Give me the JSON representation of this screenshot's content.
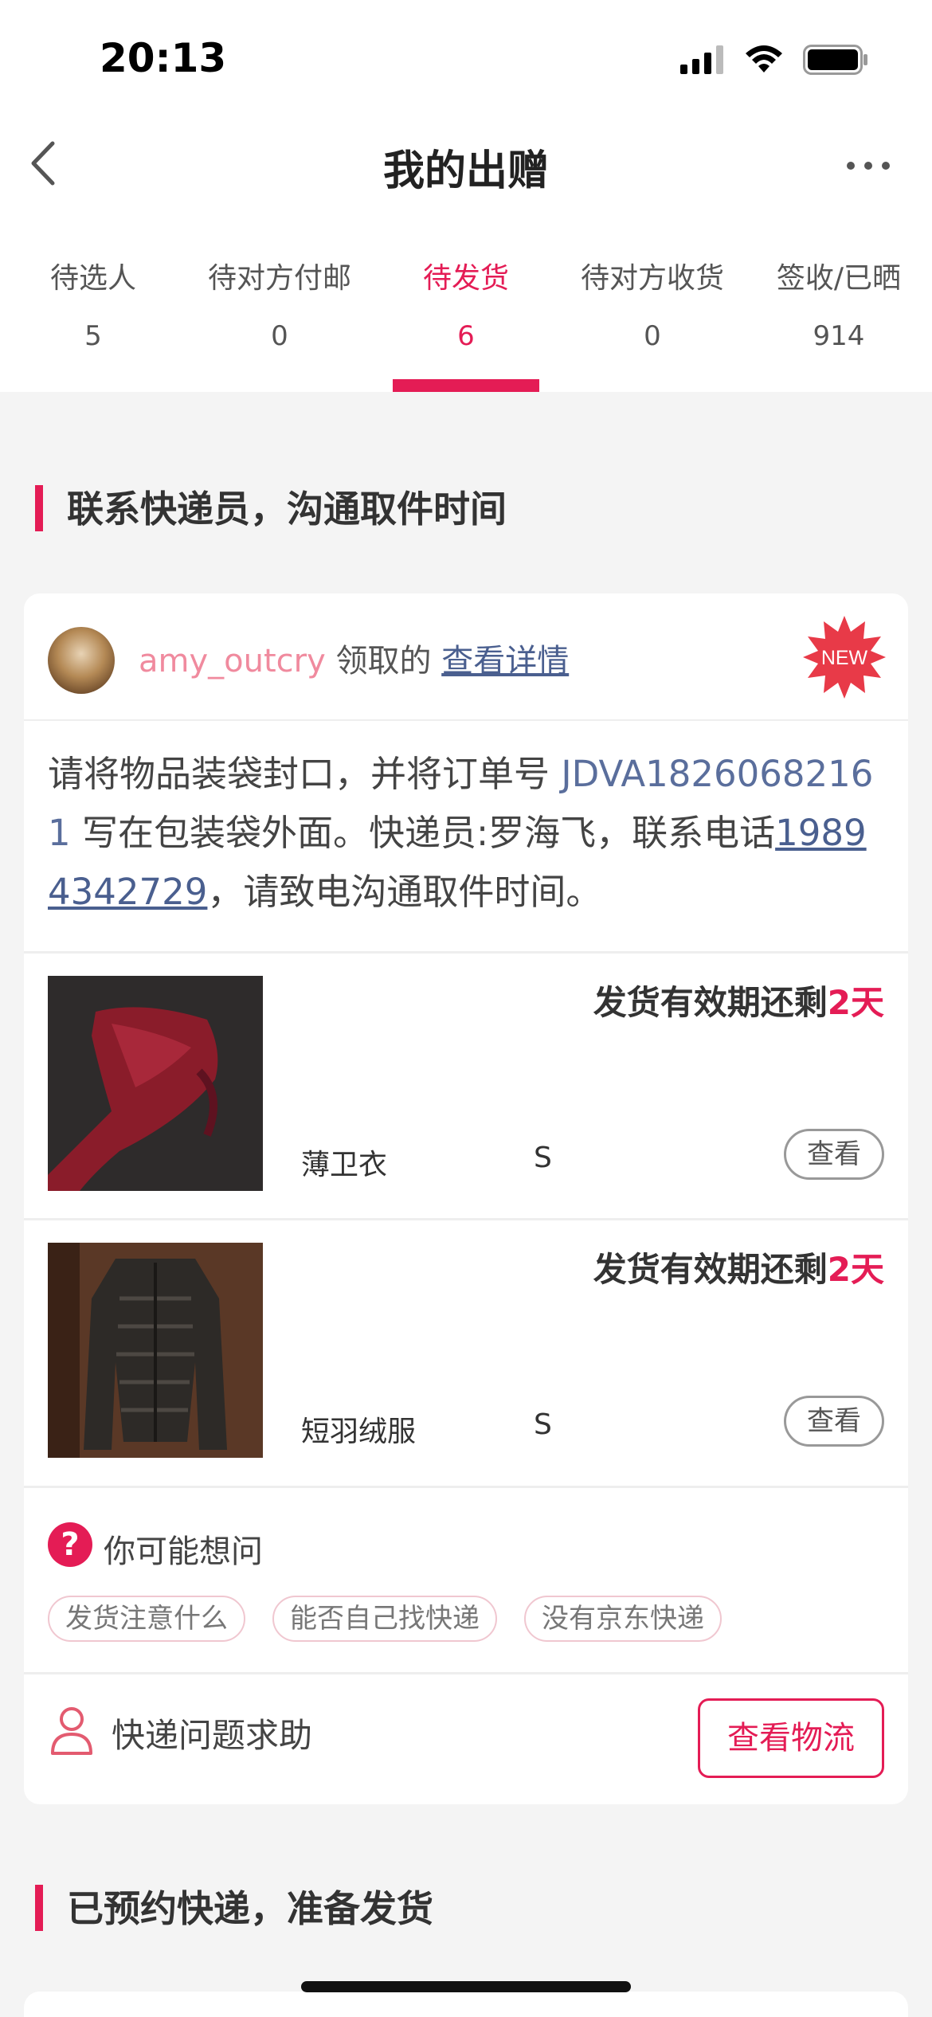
{
  "status_bar": {
    "time": "20:13"
  },
  "nav": {
    "title": "我的出赠"
  },
  "tabs": [
    {
      "label": "待选人",
      "count": "5",
      "active": false
    },
    {
      "label": "待对方付邮",
      "count": "0",
      "active": false
    },
    {
      "label": "待发货",
      "count": "6",
      "active": true
    },
    {
      "label": "待对方收货",
      "count": "0",
      "active": false
    },
    {
      "label": "签收/已晒",
      "count": "914",
      "active": false
    }
  ],
  "section1": {
    "title": "联系快递员，沟通取件时间"
  },
  "card": {
    "username": "amy_outcry",
    "claimed_text": " 领取的 ",
    "detail_link": "查看详情",
    "new_badge": "NEW",
    "notice": {
      "part1": "请将物品装袋封口，并将订单号 ",
      "order_no": "JDVA18260682161",
      "part2": " 写在包装袋外面。快递员:罗海飞，联系电话",
      "phone": "19894342729",
      "part3": "，请致电沟通取件时间。"
    },
    "items": [
      {
        "deadline_prefix": "发货有效期还剩",
        "deadline_value": "2天",
        "name": "薄卫衣",
        "size": "S",
        "view_label": "查看"
      },
      {
        "deadline_prefix": "发货有效期还剩",
        "deadline_value": "2天",
        "name": "短羽绒服",
        "size": "S",
        "view_label": "查看"
      }
    ],
    "faq": {
      "icon": "?",
      "title": "你可能想问",
      "chips": [
        "发货注意什么",
        "能否自己找快递",
        "没有京东快递"
      ]
    },
    "help": {
      "label": "快递问题求助",
      "button": "查看物流"
    }
  },
  "section2": {
    "title": "已预约快递，准备发货"
  },
  "colors": {
    "accent": "#e41c55",
    "link": "#4a5f8f"
  }
}
